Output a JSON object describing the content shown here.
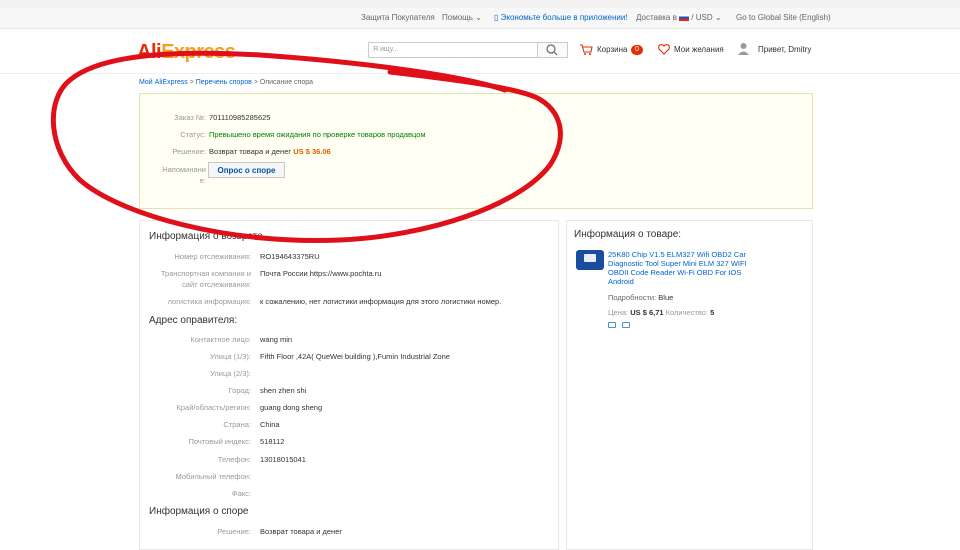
{
  "topnav": {
    "buyer_protection": "Защита Покупателя",
    "help": "Помощь",
    "app_promo": "Экономьте больше в приложении!",
    "ship_to": "Доставка в",
    "currency": "USD",
    "global_site": "Go to Global Site (English)"
  },
  "header": {
    "logo_ali": "Ali",
    "logo_express": "Express",
    "search_placeholder": "Я ищу...",
    "cart_label": "Корзина",
    "cart_count": "0",
    "wishlist_label": "Мои желания",
    "greeting": "Привет, Dmitry"
  },
  "breadcrumb": {
    "my_aliexpress": "Мой AliExpress",
    "disputes": "Перечень споров",
    "current": "Описание спора",
    "sep": " > "
  },
  "order": {
    "order_label": "Заказ №:",
    "order_value": "701110985285625",
    "status_label": "Статус:",
    "status_value": "Превышено время ожидания по проверке товаров продавцом",
    "solution_label": "Решение:",
    "solution_value": "Возврат товара и денег",
    "solution_amount": "US $ 36.06",
    "reminder_label_1": "Напоминани",
    "reminder_label_2": "е:",
    "survey_button": "Опрос о споре"
  },
  "return_info": {
    "title": "Информация о возврате",
    "tracking_label": "Номер отслеживания:",
    "tracking_value": "RO194643375RU",
    "carrier_label_1": "Транспортная компания и",
    "carrier_label_2": "сайт отслеживания:",
    "carrier_value": "Почта России https://www.pochta.ru",
    "logistics_label": "логистика информация:",
    "logistics_value": "к сожалению, нет логистики информация для этого логистики номер."
  },
  "sender": {
    "title": "Адрес оправителя:",
    "contact_label": "Контактное лицо:",
    "contact_value": "wang min",
    "street1_label": "Улица (1/3):",
    "street1_value": "Fifth Floor ,42A( QueWei building ),Fumin Industrial Zone",
    "street2_label": "Улица (2/3):",
    "street2_value": "",
    "city_label": "Город:",
    "city_value": "shen zhen shi",
    "region_label": "Край/область/регион:",
    "region_value": "guang dong sheng",
    "country_label": "Страна:",
    "country_value": "China",
    "zip_label": "Почтовый индекс:",
    "zip_value": "518112",
    "phone_label": "Телефон:",
    "phone_value": "13018015041",
    "mobile_label": "Мобильный телефон:",
    "mobile_value": "",
    "fax_label": "Факс:",
    "fax_value": ""
  },
  "dispute": {
    "title": "Информация о споре",
    "solution_label": "Решение:",
    "solution_value": "Возврат товара и денег"
  },
  "product": {
    "title": "Информация о товаре:",
    "name": "25K80 Chip V1.5 ELM327 Wifi OBD2 Car Diagnostic Tool Super Mini ELM 327 WIFI OBDII Code Reader Wi-Fi OBD For IOS Android",
    "details_label": "Подробности:",
    "details_value": "Blue",
    "price_label": "Цена:",
    "price_value": "US $ 6,71",
    "qty_label": "Количество:",
    "qty_value": "5"
  },
  "colors": {
    "brand_red": "#e62e04",
    "brand_orange": "#f7a01b",
    "status_green": "#008000",
    "link_blue": "#0066cc",
    "annotation_red": "#e0101a"
  }
}
